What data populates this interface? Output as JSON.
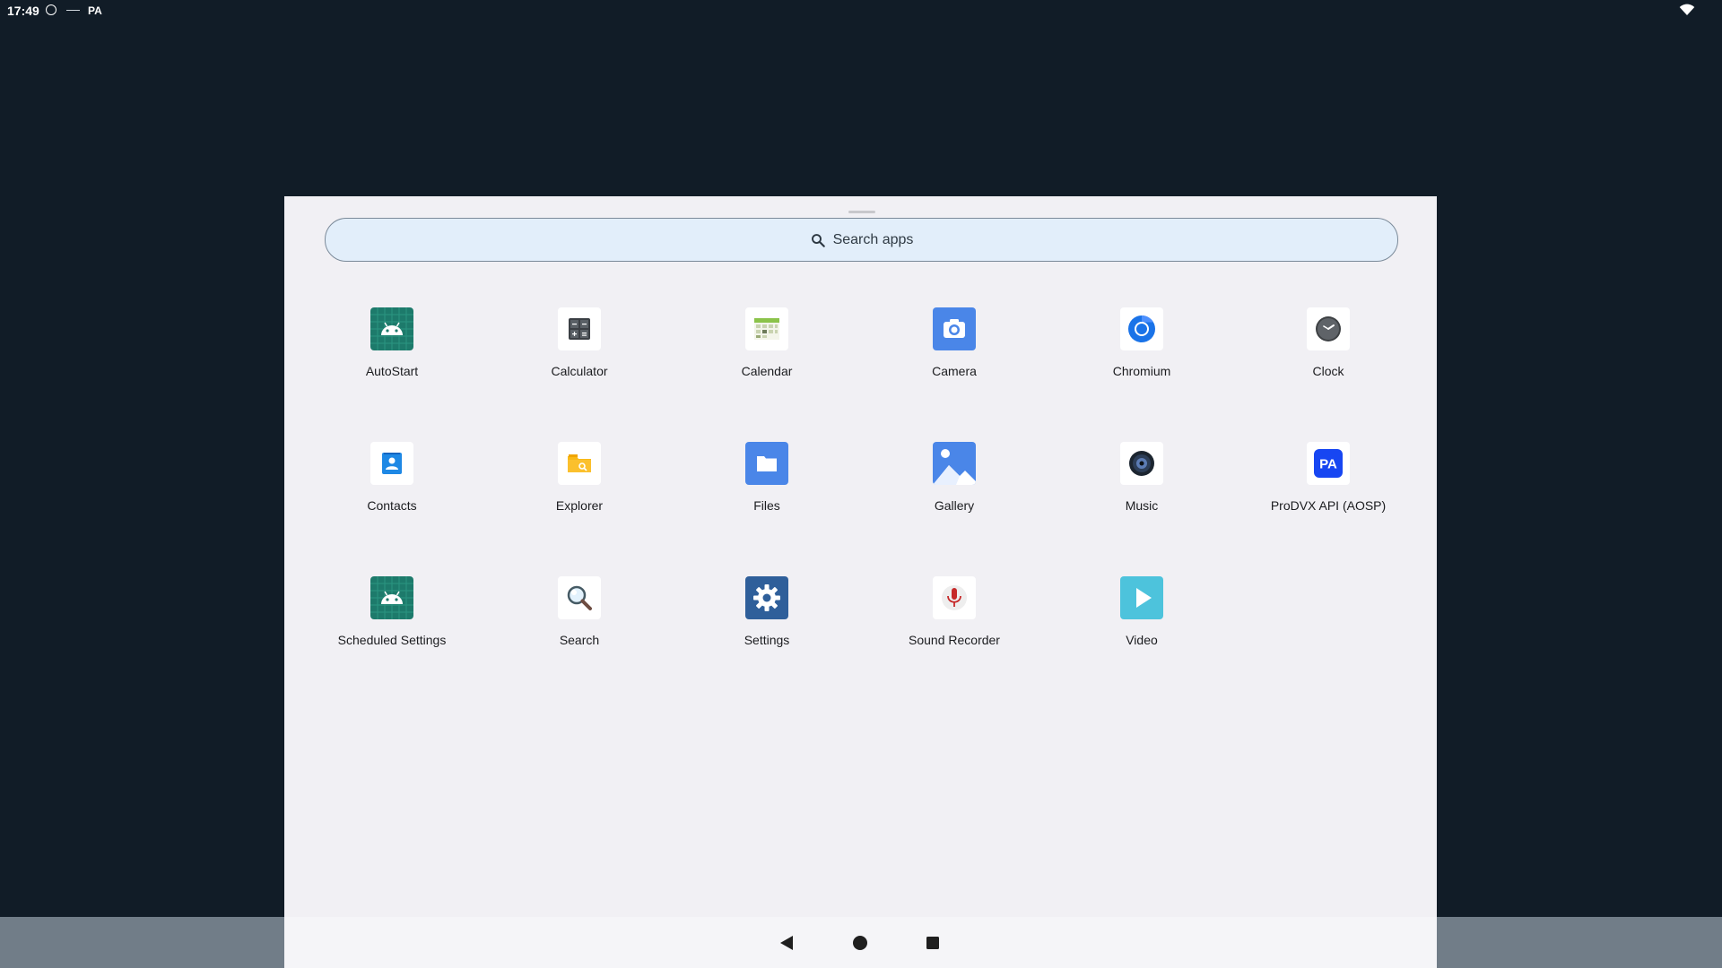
{
  "status_bar": {
    "time": "17:49",
    "carrier": "PA"
  },
  "search": {
    "placeholder": "Search apps"
  },
  "apps": [
    {
      "label": "AutoStart",
      "icon": "android-robot-icon"
    },
    {
      "label": "Calculator",
      "icon": "calculator-icon"
    },
    {
      "label": "Calendar",
      "icon": "calendar-icon"
    },
    {
      "label": "Camera",
      "icon": "camera-icon"
    },
    {
      "label": "Chromium",
      "icon": "chromium-icon"
    },
    {
      "label": "Clock",
      "icon": "clock-icon"
    },
    {
      "label": "Contacts",
      "icon": "contacts-icon"
    },
    {
      "label": "Explorer",
      "icon": "folder-explorer-icon"
    },
    {
      "label": "Files",
      "icon": "files-icon"
    },
    {
      "label": "Gallery",
      "icon": "gallery-icon"
    },
    {
      "label": "Music",
      "icon": "music-speaker-icon"
    },
    {
      "label": "ProDVX API (AOSP)",
      "icon": "prodvx-pa-icon",
      "icon_text": "PA"
    },
    {
      "label": "Scheduled Settings",
      "icon": "android-robot-icon"
    },
    {
      "label": "Search",
      "icon": "magnifier-icon"
    },
    {
      "label": "Settings",
      "icon": "gear-icon"
    },
    {
      "label": "Sound Recorder",
      "icon": "microphone-icon"
    },
    {
      "label": "Video",
      "icon": "play-icon"
    }
  ],
  "colors": {
    "wallpaper": "#111c27",
    "drawer_bg": "#f1f0f4",
    "search_bg": "#e2eefa",
    "android_green": "#1d7a6b",
    "camera_blue": "#4a86e8",
    "settings_blue": "#2f5f9a",
    "video_cyan": "#4dc3dc",
    "prodvx_blue": "#1746f2"
  },
  "nav": {
    "buttons": [
      "back",
      "home",
      "recents"
    ]
  }
}
